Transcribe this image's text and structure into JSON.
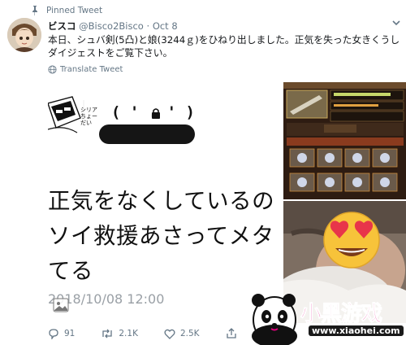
{
  "pinned": {
    "label": "Pinned Tweet"
  },
  "tweet": {
    "display_name": "ビスコ",
    "handle": "@Bisco2Bisco",
    "separator": "·",
    "date": "Oct 8",
    "text": "本日、シュバ剣(5凸)と娘(3244ｇ)をひねり出しました。正気を失った女きくうしダイジェストをご覧下さい。",
    "translate_label": "Translate Tweet"
  },
  "media": {
    "kaomoji": "( ' . ' )",
    "manga_caption": "シリア ちょーだい",
    "big_line_1": "正気をなくしているの",
    "big_line_2": "ソイ救援あさってメタ",
    "big_line_3": "てる",
    "timestamp": "2018/10/08 12:00"
  },
  "actions": {
    "replies": "91",
    "retweets": "2.1K",
    "likes": "2.5K"
  },
  "watermark": {
    "brand": "小黑游戏",
    "url": "www.xiaohei.com"
  },
  "colors": {
    "text_primary": "#14171a",
    "text_secondary": "#657786",
    "brand_magenta": "#e5007f",
    "emoji_yellow": "#f7c33a",
    "heart_red": "#e8354a"
  }
}
